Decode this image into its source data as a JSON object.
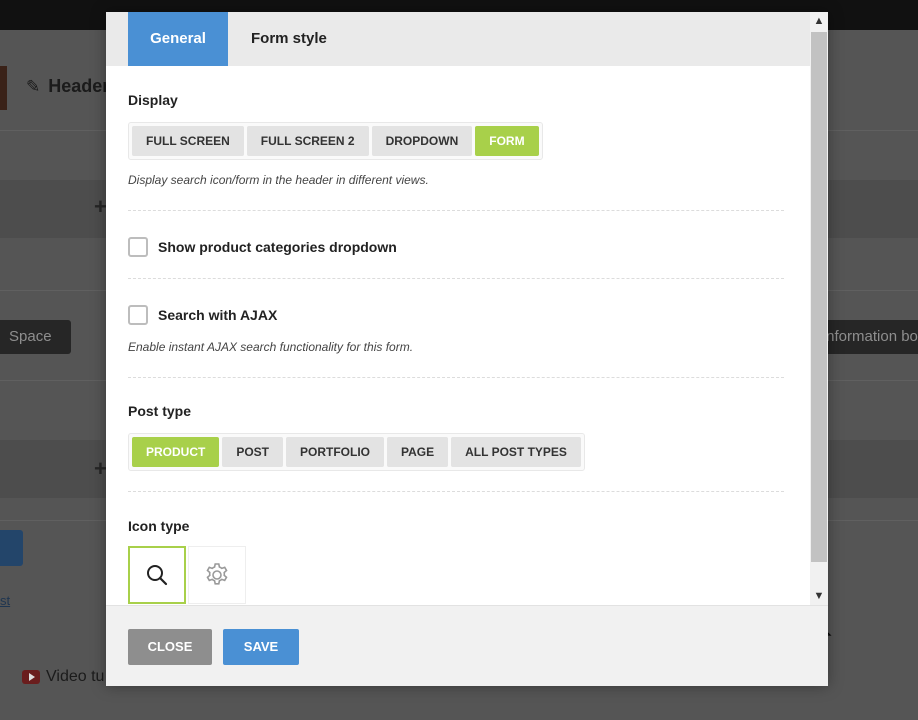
{
  "background": {
    "header_label": "Header",
    "space_label": "Space",
    "info_label": "Information box",
    "link_text": "st",
    "video_label": "Video tu"
  },
  "modal": {
    "tabs": [
      {
        "label": "General",
        "active": true
      },
      {
        "label": "Form style",
        "active": false
      }
    ],
    "display": {
      "label": "Display",
      "options": [
        "FULL SCREEN",
        "FULL SCREEN 2",
        "DROPDOWN",
        "FORM"
      ],
      "selected": "FORM",
      "hint": "Display search icon/form in the header in different views."
    },
    "categories_checkbox": {
      "label": "Show product categories dropdown",
      "checked": false
    },
    "ajax_checkbox": {
      "label": "Search with AJAX",
      "checked": false,
      "hint": "Enable instant AJAX search functionality for this form."
    },
    "post_type": {
      "label": "Post type",
      "options": [
        "PRODUCT",
        "POST",
        "PORTFOLIO",
        "PAGE",
        "ALL POST TYPES"
      ],
      "selected": "PRODUCT"
    },
    "icon_type": {
      "label": "Icon type",
      "options": [
        "search-icon",
        "gear-icon"
      ],
      "selected": "search-icon"
    },
    "footer": {
      "close_label": "CLOSE",
      "save_label": "SAVE"
    }
  },
  "colors": {
    "accent_blue": "#4a90d4",
    "accent_green": "#a8d04a",
    "close_gray": "#8e8e8e"
  }
}
